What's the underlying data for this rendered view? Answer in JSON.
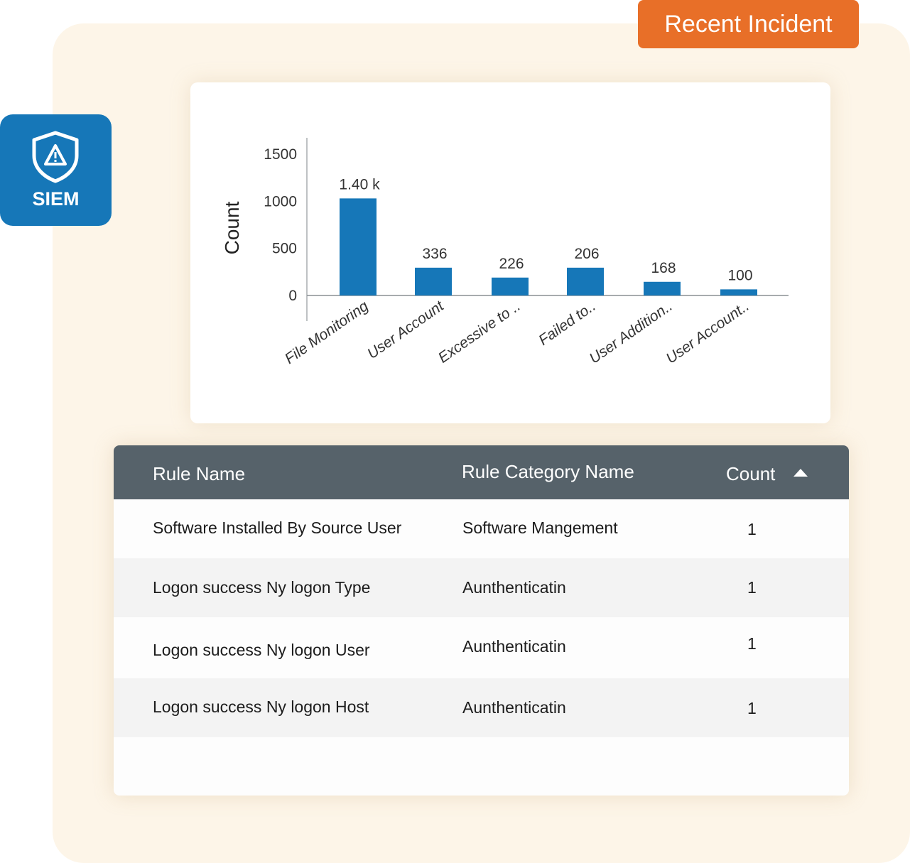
{
  "header": {
    "title": "Recent Incident"
  },
  "app_tile": {
    "icon": "shield-warning-icon",
    "label": "SIEM"
  },
  "colors": {
    "accent": "#e86f28",
    "bar": "#1677b8",
    "table_header": "#56626a",
    "panel_bg": "#fdf5e8"
  },
  "chart_data": {
    "type": "bar",
    "title": "",
    "xlabel": "",
    "ylabel": "Count",
    "ylim": [
      0,
      1500
    ],
    "yticks": [
      0,
      500,
      1000,
      1500
    ],
    "ytick_labels": [
      "0",
      "500",
      "1000",
      "1500"
    ],
    "categories": [
      "File Monitoring",
      "User Account",
      "Excessive to ..",
      "Failed to..",
      "User Addition..",
      "User Account.."
    ],
    "values": [
      1400,
      336,
      226,
      206,
      168,
      100
    ],
    "value_labels": [
      "1.40 k",
      "336",
      "226",
      "206",
      "168",
      "100"
    ],
    "rendered_heights": [
      1030,
      295,
      190,
      295,
      145,
      65
    ],
    "grid": false,
    "legend": "none"
  },
  "table": {
    "columns": [
      "Rule Name",
      "Rule Category Name",
      "Count"
    ],
    "sort": {
      "column": "Count",
      "direction": "ascending"
    },
    "rows": [
      {
        "rule": "Software Installed By Source User",
        "category": "Software Mangement",
        "count": "1"
      },
      {
        "rule": "Logon success Ny logon Type",
        "category": "Aunthenticatin",
        "count": "1"
      },
      {
        "rule": "Logon success Ny logon User",
        "category": "Aunthenticatin",
        "count": "1"
      },
      {
        "rule": "Logon success Ny logon Host",
        "category": "Aunthenticatin",
        "count": "1"
      }
    ]
  }
}
